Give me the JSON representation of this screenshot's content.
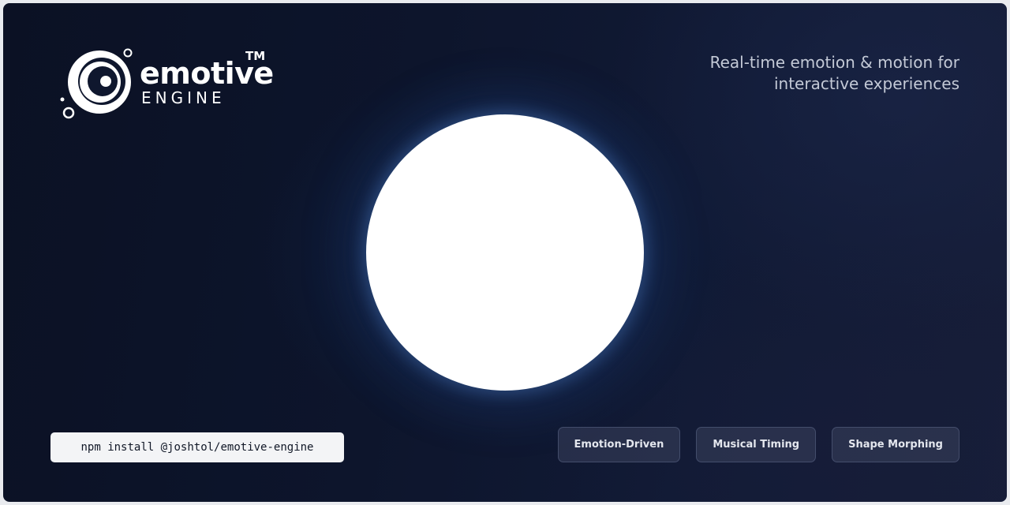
{
  "logo": {
    "word": "emotive",
    "sub": "ENGINE",
    "tm": "TM"
  },
  "tagline": {
    "line1": "Real-time emotion & motion for",
    "line2": "interactive experiences"
  },
  "install": {
    "command": "npm install @joshtol/emotive-engine"
  },
  "features": [
    {
      "label": "Emotion-Driven"
    },
    {
      "label": "Musical Timing"
    },
    {
      "label": "Shape Morphing"
    }
  ],
  "colors": {
    "background": "#0d152c",
    "orb": "#ffffff",
    "tagline": "#c3c9d6",
    "pill_bg": "#3a425c"
  }
}
